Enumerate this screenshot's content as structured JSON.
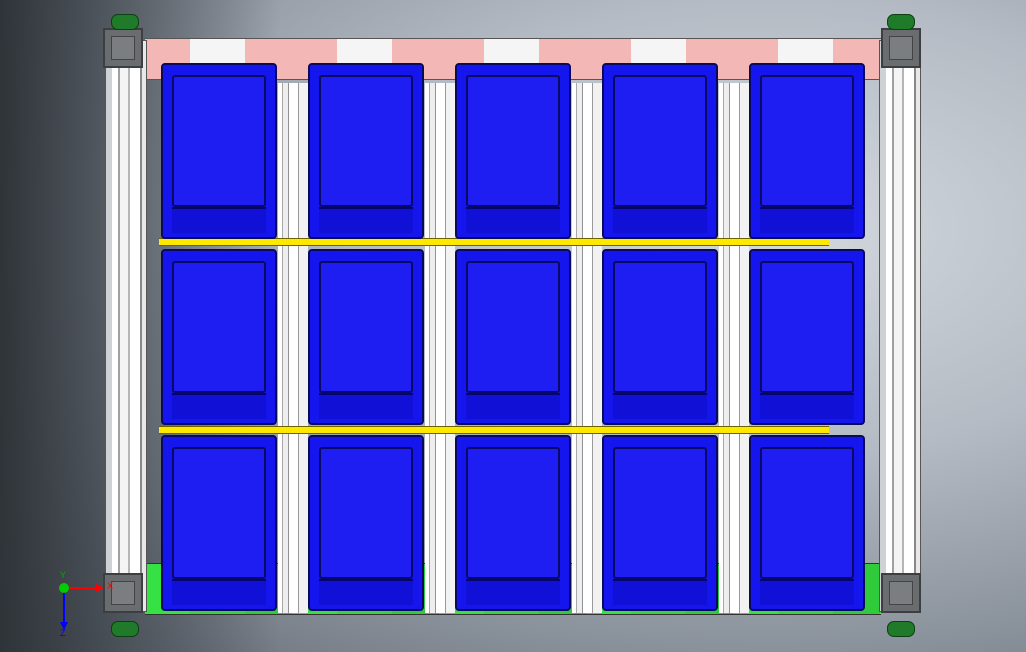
{
  "window": {
    "title": ""
  },
  "viewport": {
    "background_center": "#d4d9de",
    "background_edge": "#2f3439"
  },
  "model": {
    "bin_color": "#1515ee",
    "rail_color": "#e8e8e8",
    "top_strip_color": "#f3b8b6",
    "bottom_strip_color": "#35e143",
    "bar_color": "#ffe800",
    "caster_color": "#1f7a2a",
    "bins": {
      "rows": 3,
      "columns": 5
    }
  },
  "triad": {
    "x_label": "X",
    "y_label": "Y",
    "z_label": "Z",
    "x_color": "#ff0000",
    "y_color": "#00cc00",
    "z_color": "#0000ff"
  }
}
